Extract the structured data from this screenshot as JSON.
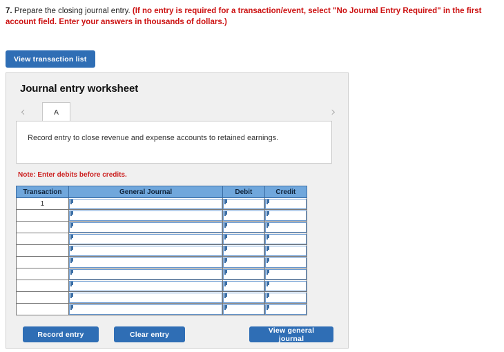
{
  "question": {
    "number": "7.",
    "text": "Prepare the closing journal entry.",
    "emphasis": "(If no entry is required for a transaction/event, select \"No Journal Entry Required\" in the first account field. Enter your answers in thousands of dollars.)"
  },
  "toolbar": {
    "view_transaction_list_label": "View transaction list"
  },
  "panel": {
    "title": "Journal entry worksheet",
    "tabs": [
      {
        "label": "A",
        "active": true
      }
    ],
    "nav": {
      "prev_icon": "chevron-left-icon",
      "next_icon": "chevron-right-icon",
      "prev_glyph": "‹",
      "next_glyph": "›"
    },
    "description": "Record entry to close revenue and expense accounts to retained earnings.",
    "note": "Note: Enter debits before credits."
  },
  "table": {
    "columns": [
      "Transaction",
      "General Journal",
      "Debit",
      "Credit"
    ],
    "rows": [
      {
        "transaction": "1",
        "general_journal": "",
        "debit": "",
        "credit": ""
      },
      {
        "transaction": "",
        "general_journal": "",
        "debit": "",
        "credit": ""
      },
      {
        "transaction": "",
        "general_journal": "",
        "debit": "",
        "credit": ""
      },
      {
        "transaction": "",
        "general_journal": "",
        "debit": "",
        "credit": ""
      },
      {
        "transaction": "",
        "general_journal": "",
        "debit": "",
        "credit": ""
      },
      {
        "transaction": "",
        "general_journal": "",
        "debit": "",
        "credit": ""
      },
      {
        "transaction": "",
        "general_journal": "",
        "debit": "",
        "credit": ""
      },
      {
        "transaction": "",
        "general_journal": "",
        "debit": "",
        "credit": ""
      },
      {
        "transaction": "",
        "general_journal": "",
        "debit": "",
        "credit": ""
      },
      {
        "transaction": "",
        "general_journal": "",
        "debit": "",
        "credit": ""
      }
    ]
  },
  "actions": {
    "record_entry_label": "Record entry",
    "clear_entry_label": "Clear entry",
    "view_general_journal_label": "View general journal"
  },
  "colors": {
    "button_blue": "#2f6eb5",
    "table_header_blue": "#70a7dc",
    "panel_gray": "#f0f0f0",
    "note_red": "#cc2222",
    "emphasis_red": "#cc1111",
    "field_border_blue": "#6b9bd2"
  }
}
